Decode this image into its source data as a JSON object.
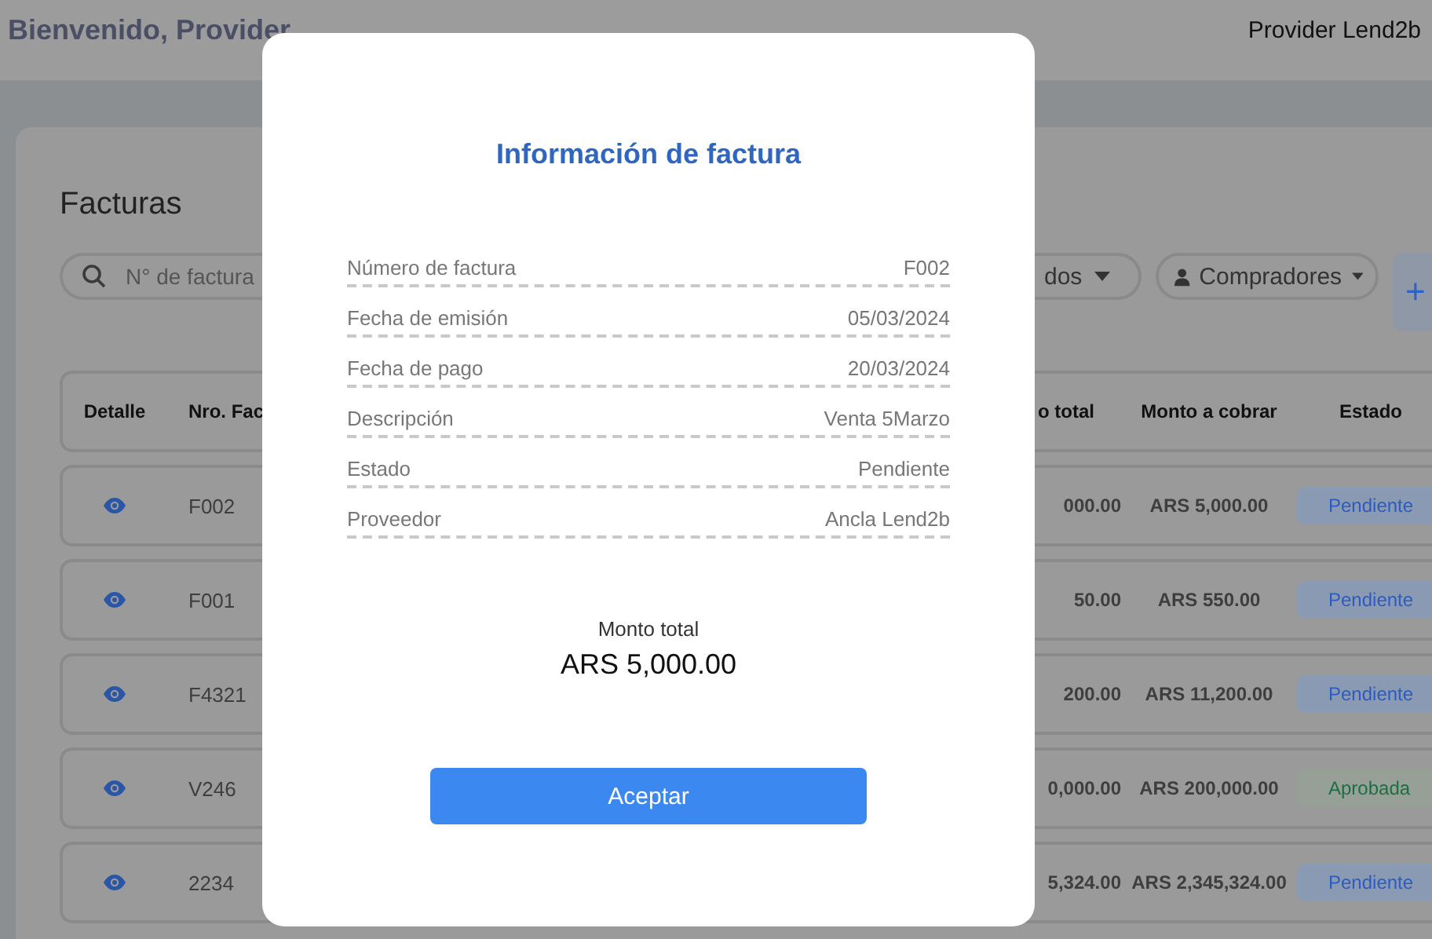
{
  "header": {
    "greeting": "Bienvenido, Provider",
    "user": "Provider Lend2b"
  },
  "page": {
    "title": "Facturas"
  },
  "filters": {
    "search_placeholder": "N° de factura",
    "status_filter": "dos",
    "buyers_filter": "Compradores",
    "add": "+"
  },
  "table": {
    "columns": [
      "Detalle",
      "Nro. Fac",
      "o total",
      "Monto a cobrar",
      "Estado"
    ],
    "rows": [
      {
        "number": "F002",
        "total": "000.00",
        "to_collect": "ARS 5,000.00",
        "status": {
          "label": "Pendiente",
          "kind": "pending"
        }
      },
      {
        "number": "F001",
        "total": "50.00",
        "to_collect": "ARS 550.00",
        "status": {
          "label": "Pendiente",
          "kind": "pending"
        }
      },
      {
        "number": "F4321",
        "total": "200.00",
        "to_collect": "ARS 11,200.00",
        "status": {
          "label": "Pendiente",
          "kind": "pending"
        }
      },
      {
        "number": "V246",
        "total": "0,000.00",
        "to_collect": "ARS 200,000.00",
        "status": {
          "label": "Aprobada",
          "kind": "approved"
        }
      },
      {
        "number": "2234",
        "total": "5,324.00",
        "to_collect": "ARS 2,345,324.00",
        "status": {
          "label": "Pendiente",
          "kind": "pending"
        }
      }
    ]
  },
  "modal": {
    "title": "Información de factura",
    "fields": [
      {
        "label": "Número de factura",
        "value": "F002"
      },
      {
        "label": "Fecha de emisión",
        "value": "05/03/2024"
      },
      {
        "label": "Fecha de pago",
        "value": "20/03/2024"
      },
      {
        "label": "Descripción",
        "value": "Venta 5Marzo"
      },
      {
        "label": "Estado",
        "value": "Pendiente"
      },
      {
        "label": "Proveedor",
        "value": "Ancla Lend2b"
      }
    ],
    "total_label": "Monto total",
    "total_value": "ARS 5,000.00",
    "button": "Aceptar"
  }
}
